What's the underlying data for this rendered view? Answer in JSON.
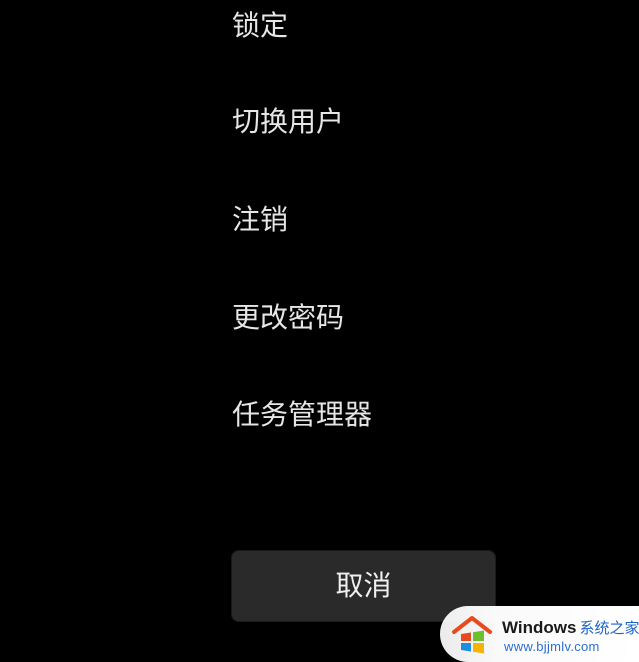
{
  "menu": {
    "items": [
      {
        "label": "锁定"
      },
      {
        "label": "切换用户"
      },
      {
        "label": "注销"
      },
      {
        "label": "更改密码"
      },
      {
        "label": "任务管理器"
      }
    ]
  },
  "cancel": {
    "label": "取消"
  },
  "watermark": {
    "brand": "Windows",
    "brand_cn": "系统之家",
    "url": "www.bjjmlv.com"
  },
  "colors": {
    "background": "#000000",
    "text": "#e6e6e6",
    "button": "#2a2a2a",
    "watermark_link": "#2c6fd0"
  }
}
